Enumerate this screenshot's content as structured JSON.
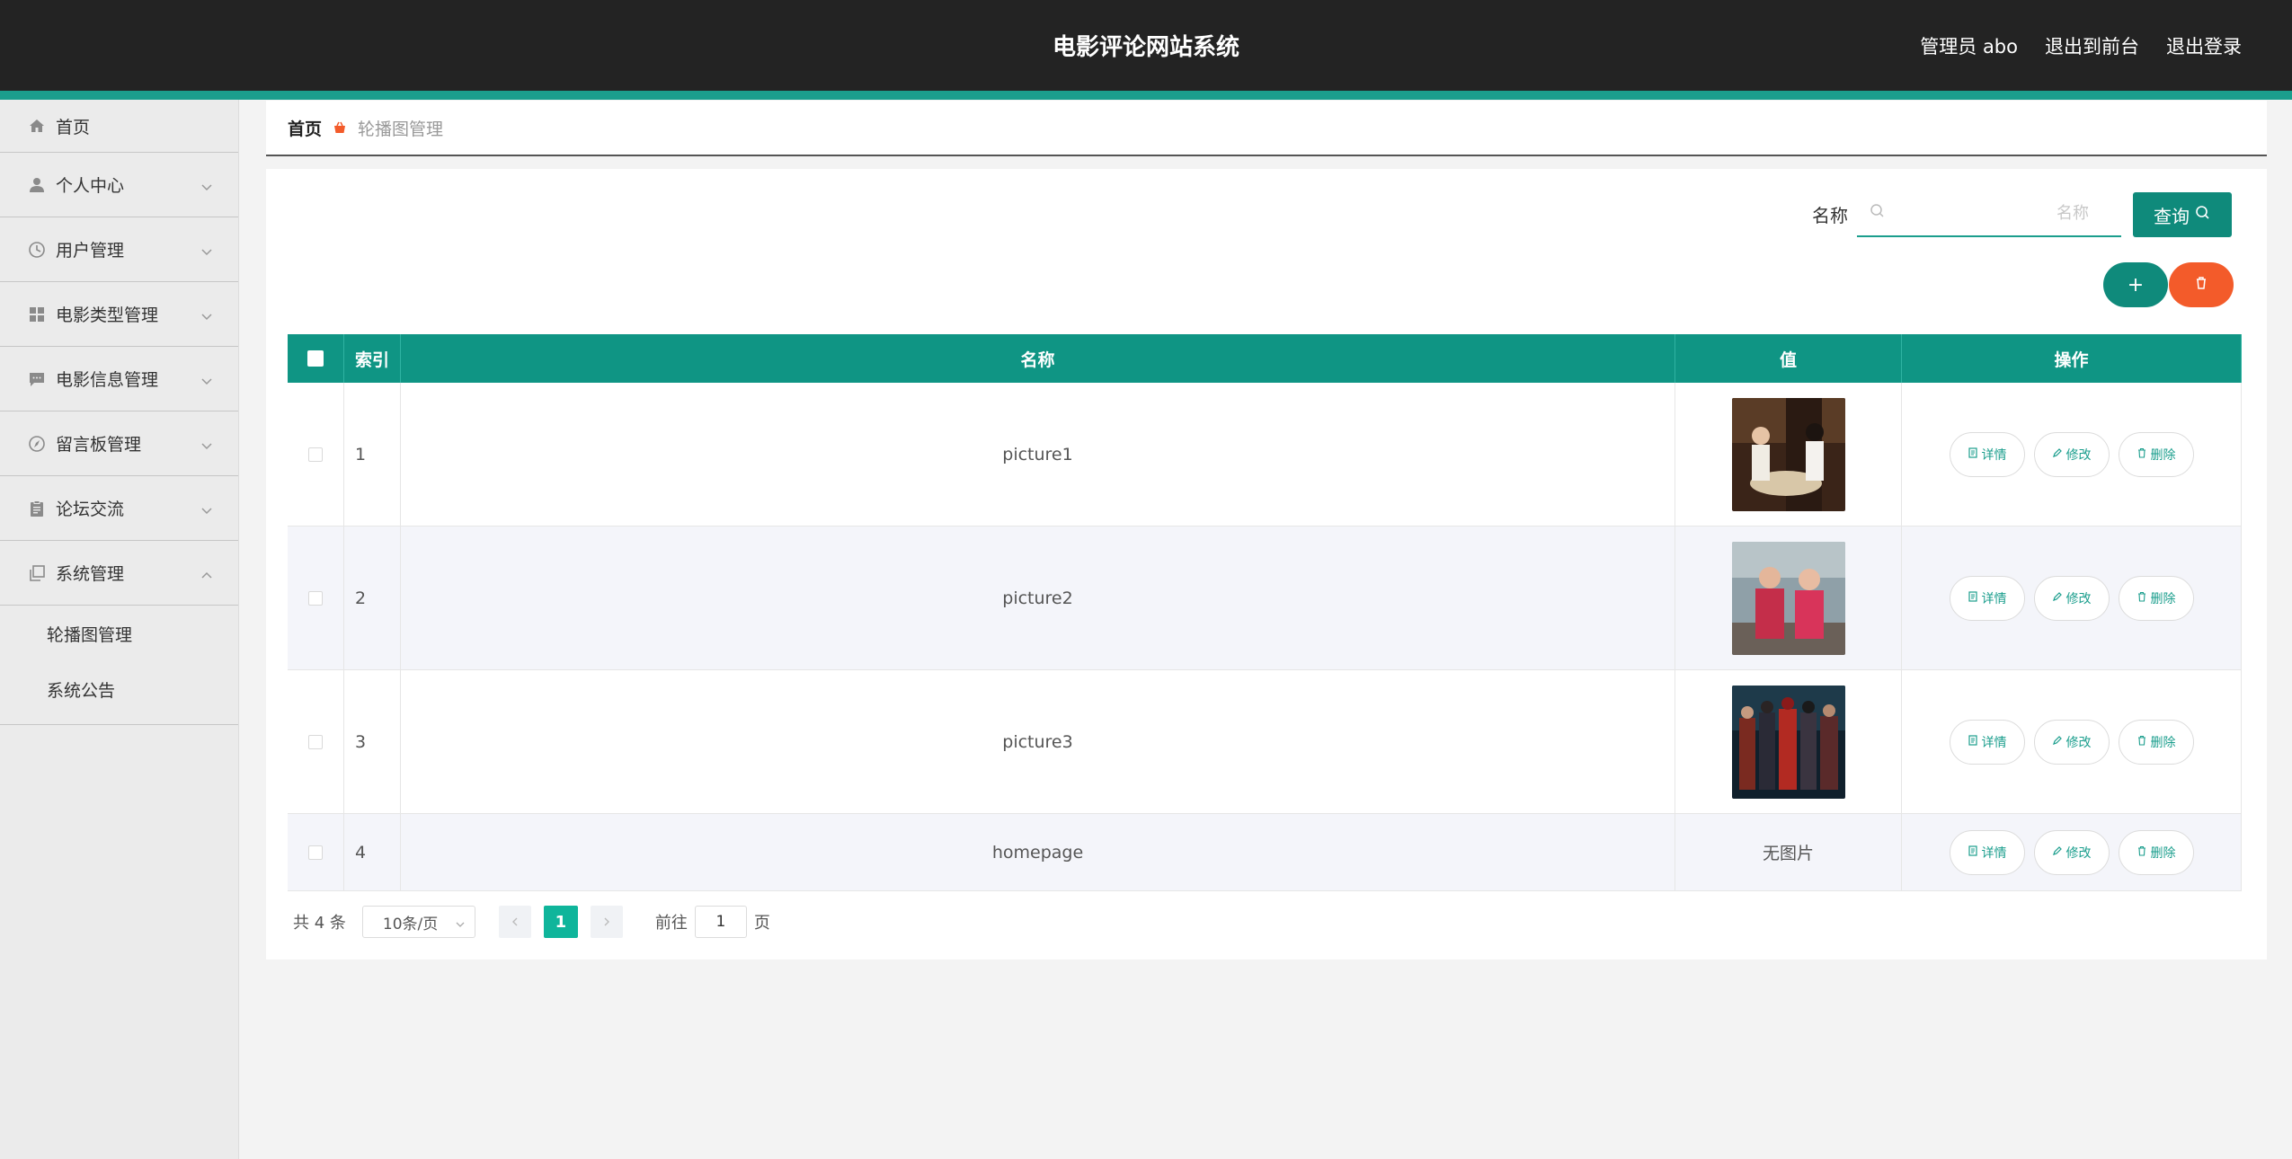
{
  "header": {
    "title": "电影评论网站系统",
    "admin": "管理员 abo",
    "to_front": "退出到前台",
    "logout": "退出登录"
  },
  "sidebar": {
    "items": [
      {
        "label": "首页",
        "icon": "home-icon"
      },
      {
        "label": "个人中心",
        "icon": "user-icon"
      },
      {
        "label": "用户管理",
        "icon": "clock-icon"
      },
      {
        "label": "电影类型管理",
        "icon": "grid-icon"
      },
      {
        "label": "电影信息管理",
        "icon": "chat-icon"
      },
      {
        "label": "留言板管理",
        "icon": "compass-icon"
      },
      {
        "label": "论坛交流",
        "icon": "clipboard-icon"
      },
      {
        "label": "系统管理",
        "icon": "copy-icon"
      }
    ],
    "submenu": [
      "轮播图管理",
      "系统公告"
    ]
  },
  "breadcrumb": {
    "home": "首页",
    "current": "轮播图管理"
  },
  "search": {
    "label": "名称",
    "placeholder": "名称",
    "button": "查询"
  },
  "actions": {
    "add": "+"
  },
  "table": {
    "headers": [
      "索引",
      "名称",
      "值",
      "操作"
    ],
    "rows": [
      {
        "index": "1",
        "name": "picture1",
        "value": ""
      },
      {
        "index": "2",
        "name": "picture2",
        "value": ""
      },
      {
        "index": "3",
        "name": "picture3",
        "value": ""
      },
      {
        "index": "4",
        "name": "homepage",
        "value": "无图片"
      }
    ],
    "ops": {
      "detail": "详情",
      "edit": "修改",
      "delete": "删除"
    }
  },
  "pagination": {
    "total": "共 4 条",
    "page_size": "10条/页",
    "current": "1",
    "goto_prefix": "前往",
    "goto_value": "1",
    "goto_suffix": "页"
  },
  "colors": {
    "accent": "#0f9584",
    "danger": "#f35b2a",
    "header_bg": "#232323"
  }
}
